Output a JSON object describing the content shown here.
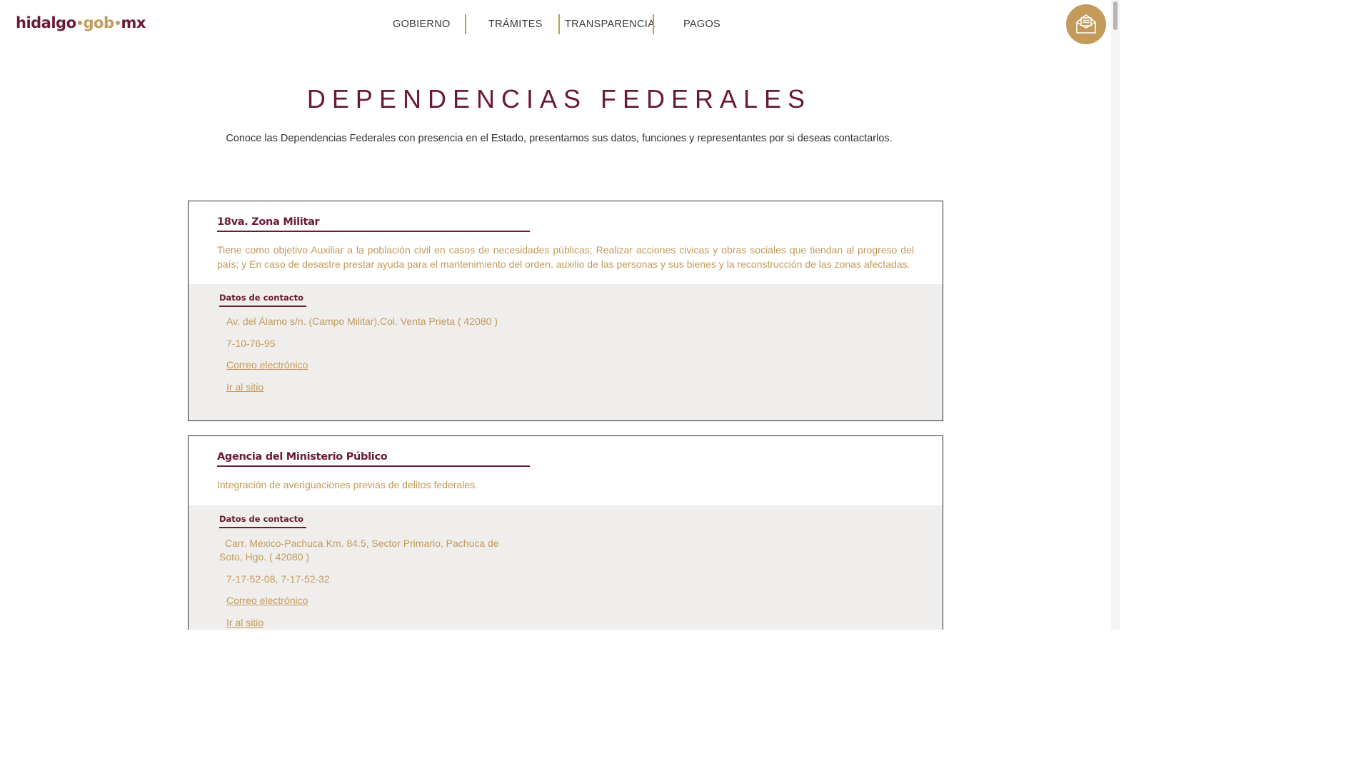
{
  "header": {
    "logo": {
      "part1": "hidalgo",
      "part2": "gob",
      "part3": "mx"
    },
    "nav": [
      {
        "label": "GOBIERNO"
      },
      {
        "label": "TRÁMITES"
      },
      {
        "label": "TRANSPARENCIA"
      },
      {
        "label": "PAGOS"
      }
    ],
    "mail_icon": "envelope-icon"
  },
  "main": {
    "title": "DEPENDENCIAS FEDERALES",
    "intro": "Conoce las Dependencias Federales con presencia en el Estado, presentamos sus datos, funciones y representantes por si deseas contactarlos."
  },
  "dependencies": [
    {
      "name": "18va. Zona Militar",
      "description": "Tiene como objetivo Auxiliar a la población civil en casos de necesidades públicas; Realizar acciones civicas y obras sociales que tiendan al progreso del país; y En caso de desastre prestar ayuda para el mantenimiento del orden, auxilio de las personas y sus bienes y la reconstrucción de las zonas afectadas.",
      "contact_heading": "Datos de contacto",
      "address": "Av. del Álamo s/n. (Campo Militar),Col. Venta Prieta ( 42080 )",
      "phone": "7-10-76-95",
      "email_label": "Correo electrónico",
      "site_label": "Ir al sitio"
    },
    {
      "name": "Agencia del Ministerio Público",
      "description": "Integración de averiguaciones previas de delitos federales.",
      "contact_heading": "Datos de contacto",
      "address": "Carr. México-Pachuca Km. 84.5, Sector Primario, Pachuca de Soto, Hgo. ( 42080 )",
      "phone": "7-17-52-08, 7-17-52-32",
      "email_label": "Correo electrónico",
      "site_label": "Ir al sitio"
    }
  ],
  "colors": {
    "brand": "#6b1a33",
    "accent": "#c29a5a",
    "contact_bg": "#f0eeec"
  }
}
